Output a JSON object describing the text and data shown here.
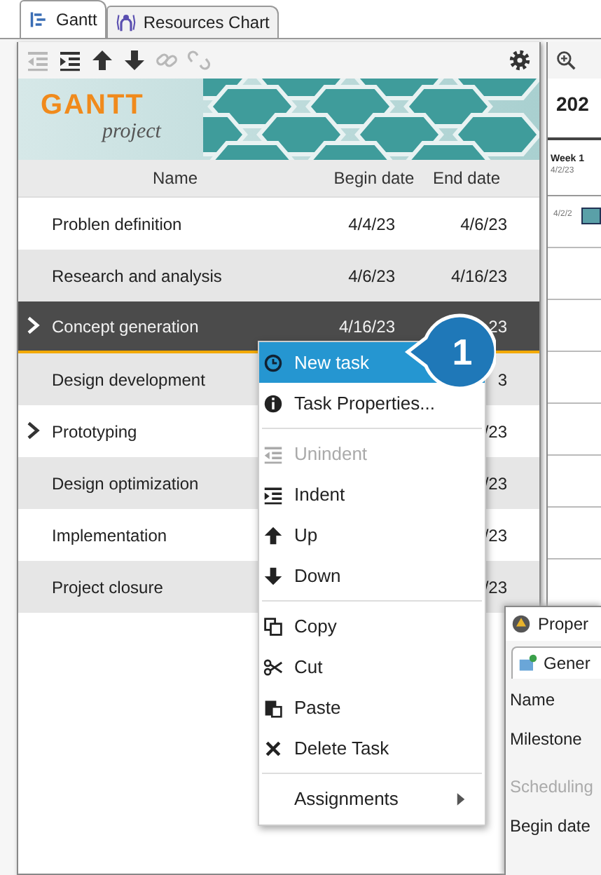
{
  "tabs": [
    {
      "label": "Gantt",
      "selected": true
    },
    {
      "label": "Resources Chart",
      "selected": false
    }
  ],
  "toolbar": [
    {
      "kind": "unindent",
      "disabled": true
    },
    {
      "kind": "indent",
      "disabled": false
    },
    {
      "kind": "up",
      "disabled": false
    },
    {
      "kind": "down",
      "disabled": false
    },
    {
      "kind": "link",
      "disabled": true
    },
    {
      "kind": "unlink",
      "disabled": true
    },
    {
      "kind": "settings",
      "disabled": false
    }
  ],
  "logo": {
    "title": "GANTT",
    "subtitle": "project"
  },
  "table": {
    "columns": [
      "Name",
      "Begin date",
      "End date"
    ],
    "rows": [
      {
        "name": "Problen definition",
        "begin": "4/4/23",
        "end": "4/6/23",
        "expandable": false,
        "selected": false
      },
      {
        "name": "Research and analysis",
        "begin": "4/6/23",
        "end": "4/16/23",
        "expandable": false,
        "selected": false
      },
      {
        "name": "Concept generation",
        "begin": "4/16/23",
        "end": "23",
        "expandable": true,
        "selected": true
      },
      {
        "name": "Design development",
        "end": "3",
        "expandable": false,
        "selected": false
      },
      {
        "name": "Prototyping",
        "end": "/23",
        "expandable": true,
        "selected": false
      },
      {
        "name": "Design optimization",
        "end": "/23",
        "expandable": false,
        "selected": false
      },
      {
        "name": "Implementation",
        "end": "/23",
        "expandable": false,
        "selected": false
      },
      {
        "name": "Project closure",
        "end": "/23",
        "expandable": false,
        "selected": false
      }
    ]
  },
  "chart_panel": {
    "year": "202",
    "week": "Week 1",
    "date": "4/2/23",
    "bar_label": "4/2/2"
  },
  "context_menu": [
    {
      "kind": "item",
      "label": "New task",
      "selected": true,
      "disabled": false
    },
    {
      "kind": "item",
      "label": "Task Properties...",
      "selected": false,
      "disabled": false
    },
    {
      "kind": "separator"
    },
    {
      "kind": "item",
      "label": "Unindent",
      "selected": false,
      "disabled": true
    },
    {
      "kind": "item",
      "label": "Indent",
      "selected": false,
      "disabled": false
    },
    {
      "kind": "item",
      "label": "Up",
      "selected": false,
      "disabled": false
    },
    {
      "kind": "item",
      "label": "Down",
      "selected": false,
      "disabled": false
    },
    {
      "kind": "separator"
    },
    {
      "kind": "item",
      "label": "Copy",
      "selected": false,
      "disabled": false
    },
    {
      "kind": "item",
      "label": "Cut",
      "selected": false,
      "disabled": false
    },
    {
      "kind": "item",
      "label": "Paste",
      "selected": false,
      "disabled": false
    },
    {
      "kind": "item",
      "label": "Delete Task",
      "selected": false,
      "disabled": false
    },
    {
      "kind": "separator"
    },
    {
      "kind": "submenu",
      "label": "Assignments",
      "selected": false,
      "disabled": false
    }
  ],
  "callout": {
    "number": "1"
  },
  "properties_dialog": {
    "title": "Proper",
    "tab": "Gener",
    "fields": [
      {
        "label": "Name",
        "kind": "field"
      },
      {
        "label": "Milestone",
        "kind": "field"
      },
      {
        "label": "Scheduling",
        "kind": "section"
      },
      {
        "label": "Begin date",
        "kind": "field"
      }
    ]
  }
}
